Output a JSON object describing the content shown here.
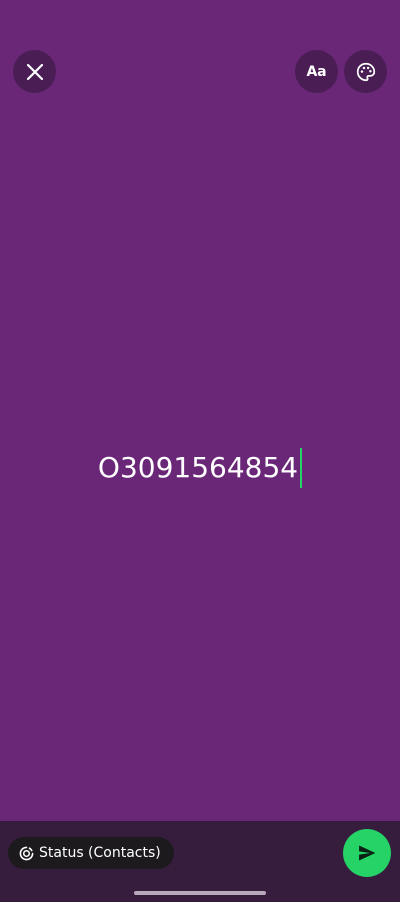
{
  "toolbar": {
    "font_label": "Aa"
  },
  "status": {
    "text": "O3091564854",
    "cursor_color": "#25d366"
  },
  "bottom": {
    "audience_label": "Status (Contacts)"
  },
  "colors": {
    "background": "#6a2778",
    "button_bg": "#4a1d55",
    "bottom_bar": "#361d3d",
    "send_button": "#25d366"
  },
  "icons": {
    "close": "close-icon",
    "palette": "palette-icon",
    "audience": "status-ring-icon",
    "send": "send-icon"
  }
}
